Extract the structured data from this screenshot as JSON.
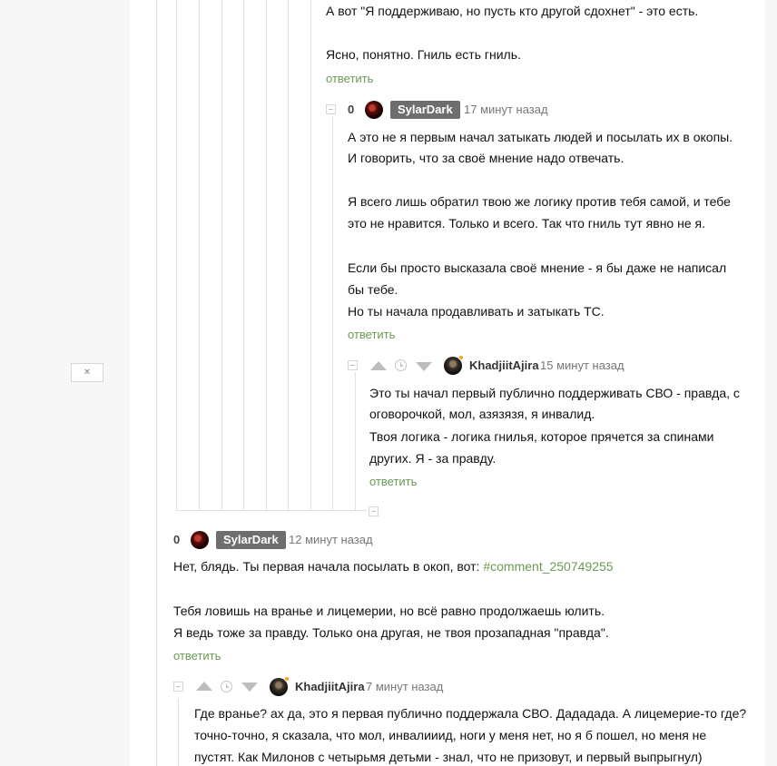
{
  "close_button_glyph": "×",
  "reply_label": "ответить",
  "comments": {
    "c0": {
      "lines": [
        "А вот \"Я поддерживаю, но пусть кто другой сдохнет\" - это есть.",
        "Ясно, понятно. Гниль есть гниль."
      ]
    },
    "c1": {
      "rating": "0",
      "author": "SylarDark",
      "time": "17 минут назад",
      "lines": [
        "А это не я первым начал затыкать людей и посылать их в окопы.",
        "И говорить, что за своё мнение надо отвечать.",
        "Я всего лишь обратил твою же логику против тебя самой, и тебе",
        "это не нравится. Только и всего. Так что гниль тут явно не я.",
        "Если бы просто высказала своё мнение - я бы даже не написал",
        "бы тебе.",
        "Но ты начала продавливать и затыкать ТС."
      ]
    },
    "c2": {
      "author": "KhadjiitAjira",
      "time": "15 минут назад",
      "lines": [
        "Это ты начал первый публично поддерживать СВО - правда, с",
        "оговорочкой, мол, азязязя, я инвалид.",
        "Твоя логика - логика гнилья, которое прячется за спинами",
        "других. Я - за правду."
      ]
    },
    "c3": {
      "rating": "0",
      "author": "SylarDark",
      "time": "12 минут назад",
      "line1_text": "Нет, блядь. Ты первая начала посылать в окоп, вот: ",
      "line1_link": "#comment_250749255",
      "lines": [
        "Тебя ловишь на вранье и лицемерии, но всё равно продолжаешь юлить.",
        "Я ведь тоже за правду. Только она другая, не твоя прозападная \"правда\"."
      ]
    },
    "c4": {
      "author": "KhadjiitAjira",
      "time": "7 минут назад",
      "lines": [
        "Где вранье? ах да, это я первая публично поддержала СВО. Дададада. А лицемерие-то где?",
        "точно-точно, я сказала, что мол, инвалииид, ноги у меня нет, но я б пошел, но меня не",
        "пустят. Как Милонов с четырьмя детьми - знал, что не призовут, и первый выпрыгнул)"
      ]
    }
  },
  "colors": {
    "link": "#6a9b52",
    "badge": "#6e6e6e",
    "online": "#f2a81d"
  }
}
